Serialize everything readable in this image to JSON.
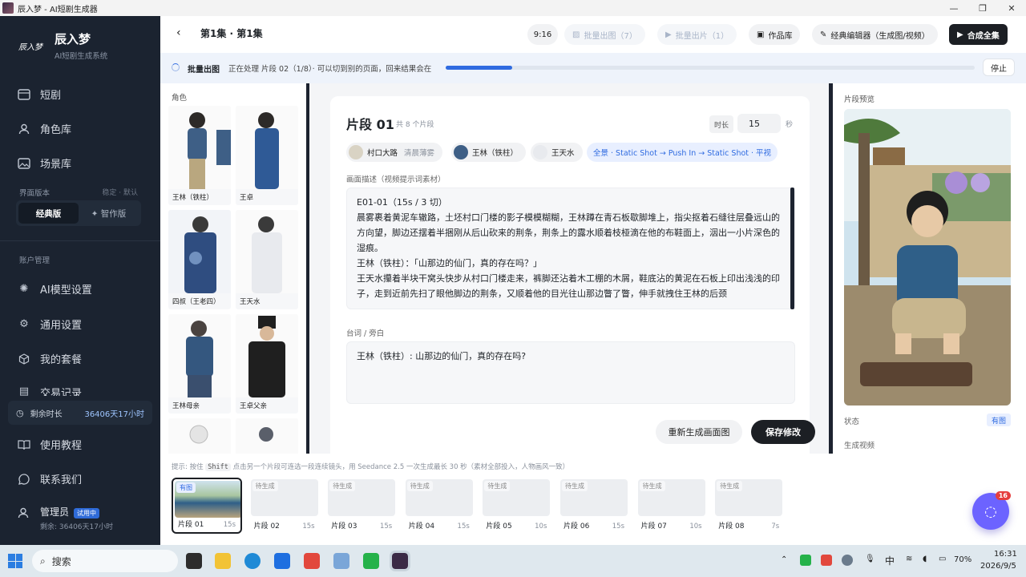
{
  "window": {
    "title": "辰入梦 - AI短剧生成器"
  },
  "brand": {
    "logo_text": "辰入梦",
    "name": "辰入梦",
    "subtitle": "AI短剧生成系统"
  },
  "nav": {
    "items": [
      {
        "label": "短剧",
        "icon": "film-icon"
      },
      {
        "label": "角色库",
        "icon": "user-icon"
      },
      {
        "label": "场景库",
        "icon": "image-icon"
      }
    ]
  },
  "version": {
    "label": "界面版本",
    "right": "稳定 · 默认",
    "options": [
      "经典版",
      "✦ 智作版"
    ]
  },
  "account": {
    "label": "账户管理",
    "items": [
      {
        "label": "AI模型设置"
      },
      {
        "label": "通用设置"
      },
      {
        "label": "我的套餐"
      },
      {
        "label": "交易记录"
      },
      {
        "label": "使用教程"
      },
      {
        "label": "联系我们"
      }
    ]
  },
  "remaining": {
    "label": "剩余时长",
    "value": "36406天17小时"
  },
  "user": {
    "name": "管理员",
    "badge": "试用中",
    "remain": "剩余: 36406天17小时"
  },
  "topbar": {
    "episode": "第1集 · 第1集",
    "ratio": "9:16",
    "batch_image": "批量出图（7）",
    "batch_video": "批量出片（1）",
    "library": "作品库",
    "classic_editor": "经典编辑器（生成图/视频）",
    "compose": "合成全集"
  },
  "progress": {
    "label": "批量出图",
    "text": "正在处理 片段 02（1/8）· 可以切到别的页面，回来结果会在",
    "fraction": 0.125,
    "stop": "停止"
  },
  "characters": {
    "header": "角色",
    "items": [
      "王林（铁柱）",
      "王卓",
      "四叔（王老四）",
      "王天水",
      "王林母亲",
      "王卓父亲",
      "",
      ""
    ]
  },
  "segment": {
    "title": "片段 01",
    "count": "共 8 个片段",
    "duration_label": "时长",
    "duration": "15",
    "duration_unit": "秒",
    "chips": [
      {
        "label": "村口大路",
        "sub": "清晨薄雾"
      },
      {
        "label": "王林（铁柱）",
        "sub": ""
      },
      {
        "label": "王天水",
        "sub": ""
      }
    ],
    "camera": "全景 · Static Shot → Push In → Static Shot · 平视",
    "desc_label": "画面描述（视频提示词素材）",
    "desc_lines": [
      "E01-01（15s / 3 切）",
      "晨雾裹着黄泥车辙路，土坯村口门楼的影子模模糊糊，王林蹲在青石板歇脚堆上，指尖抠着石缝往层叠远山的方向望，脚边还摆着半捆刚从后山砍来的荆条，荆条上的露水顺着枝桠滴在他的布鞋面上，洇出一小片深色的湿痕。",
      "王林（铁柱）：「山那边的仙门，真的存在吗？」",
      "王天水攥着半块干窝头快步从村口门楼走来，裤脚还沾着木工棚的木屑，鞋底沾的黄泥在石板上印出浅浅的印子，走到近前先扫了眼他脚边的荆条，又顺着他的目光往山那边瞥了瞥，伸手就拽住王林的后颈"
    ],
    "dialog_label": "台词 / 旁白",
    "dialog": "王林（铁柱）: 山那边的仙门，真的存在吗?",
    "regen": "重新生成画面图",
    "save": "保存修改"
  },
  "preview": {
    "header": "片段预览",
    "status_label": "状态",
    "status": "有图",
    "gen_video": "生成视频"
  },
  "bottom": {
    "hint_pre": "提示: 按住",
    "hint_key": "Shift",
    "hint_post": "点击另一个片段可连选一段连续镜头，用 Seedance 2.5 一次生成最长 30 秒（素材全部投入，人物画风一致）",
    "segments": [
      {
        "name": "片段 01",
        "dur": "15s",
        "status": "有图"
      },
      {
        "name": "片段 02",
        "dur": "15s",
        "status": "待生成"
      },
      {
        "name": "片段 03",
        "dur": "15s",
        "status": "待生成"
      },
      {
        "name": "片段 04",
        "dur": "15s",
        "status": "待生成"
      },
      {
        "name": "片段 05",
        "dur": "10s",
        "status": "待生成"
      },
      {
        "name": "片段 06",
        "dur": "15s",
        "status": "待生成"
      },
      {
        "name": "片段 07",
        "dur": "10s",
        "status": "待生成"
      },
      {
        "name": "片段 08",
        "dur": "7s",
        "status": "待生成"
      }
    ]
  },
  "fab": {
    "count": "16"
  },
  "taskbar": {
    "search": "搜索",
    "ime": "中",
    "battery": "70%",
    "time": "16:31",
    "date": "2026/9/5"
  },
  "colors": {
    "sidebar": "#1b2330",
    "accent": "#2f6be0",
    "primary_button": "#1c1f24",
    "fab": "#6c63ff"
  }
}
